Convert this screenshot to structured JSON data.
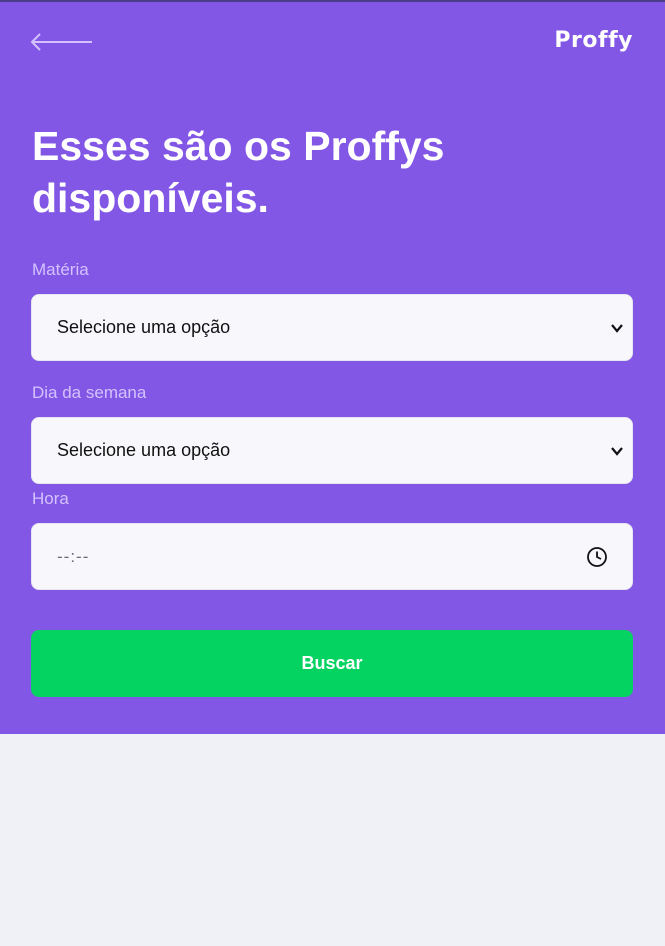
{
  "header": {
    "back_icon": "arrow-left-icon",
    "logo": "Proffy"
  },
  "page": {
    "title_line1": "Esses são os Proffys",
    "title_line2": "disponíveis."
  },
  "form": {
    "subject": {
      "label": "Matéria",
      "value": "Selecione uma opção"
    },
    "weekday": {
      "label": "Dia da semana",
      "value": "Selecione uma opção"
    },
    "time": {
      "label": "Hora",
      "placeholder": "--:--",
      "icon": "clock-icon"
    },
    "submit_label": "Buscar"
  },
  "colors": {
    "primary": "#8257e5",
    "secondary": "#04d361",
    "background": "#f0f0f7"
  }
}
